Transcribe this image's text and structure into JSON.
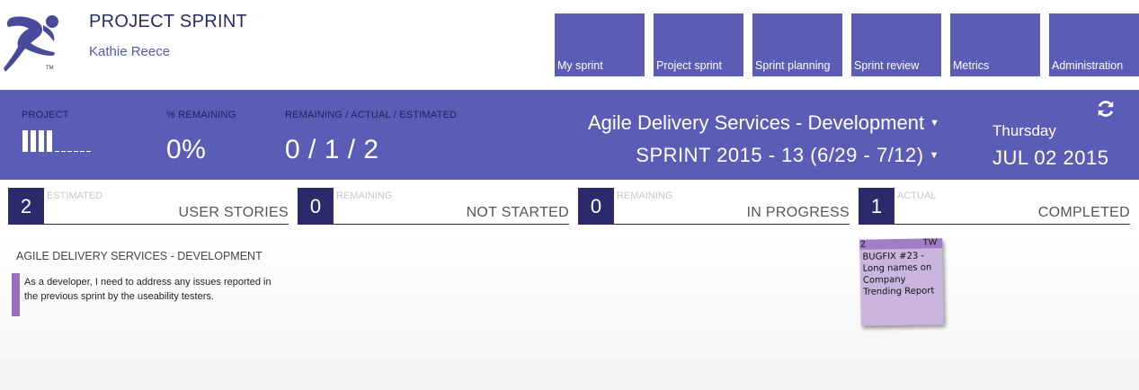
{
  "header": {
    "app_title": "PROJECT SPRINT",
    "user_name": "Kathie Reece",
    "logo_mark": "TM"
  },
  "nav": {
    "items": [
      {
        "label": "My sprint"
      },
      {
        "label": "Project sprint"
      },
      {
        "label": "Sprint planning"
      },
      {
        "label": "Sprint review"
      },
      {
        "label": "Metrics"
      },
      {
        "label": "Administration"
      }
    ]
  },
  "band": {
    "project_label": "PROJECT",
    "project_progress": 0.4,
    "remaining_label": "% REMAINING",
    "remaining_value": "0%",
    "counts_label": "REMAINING / ACTUAL / ESTIMATED",
    "counts_value": "0 / 1 / 2",
    "project_name": "Agile Delivery Services - Development",
    "sprint_name": "SPRINT 2015 - 13 (6/29 - 7/12)",
    "weekday": "Thursday",
    "date": "JUL 02 2015"
  },
  "stats": [
    {
      "number": "2",
      "caption": "ESTIMATED",
      "label": "USER STORIES"
    },
    {
      "number": "0",
      "caption": "REMAINING",
      "label": "NOT STARTED"
    },
    {
      "number": "0",
      "caption": "REMAINING",
      "label": "IN PROGRESS"
    },
    {
      "number": "1",
      "caption": "ACTUAL",
      "label": "COMPLETED"
    }
  ],
  "board": {
    "team_title": "AGILE DELIVERY SERVICES - DEVELOPMENT",
    "story_text": "As a developer, I need to address any issues reported in the previous sprint by the useability testers.",
    "story_color": "#9a6fc0",
    "task": {
      "points": "2",
      "initials": "TW",
      "text": "BUGFIX #23 - Long names on Company Trending Report"
    }
  },
  "colors": {
    "accent": "#5a5cb6",
    "dark": "#2b2a6b",
    "sticky": "#c9b5de"
  }
}
